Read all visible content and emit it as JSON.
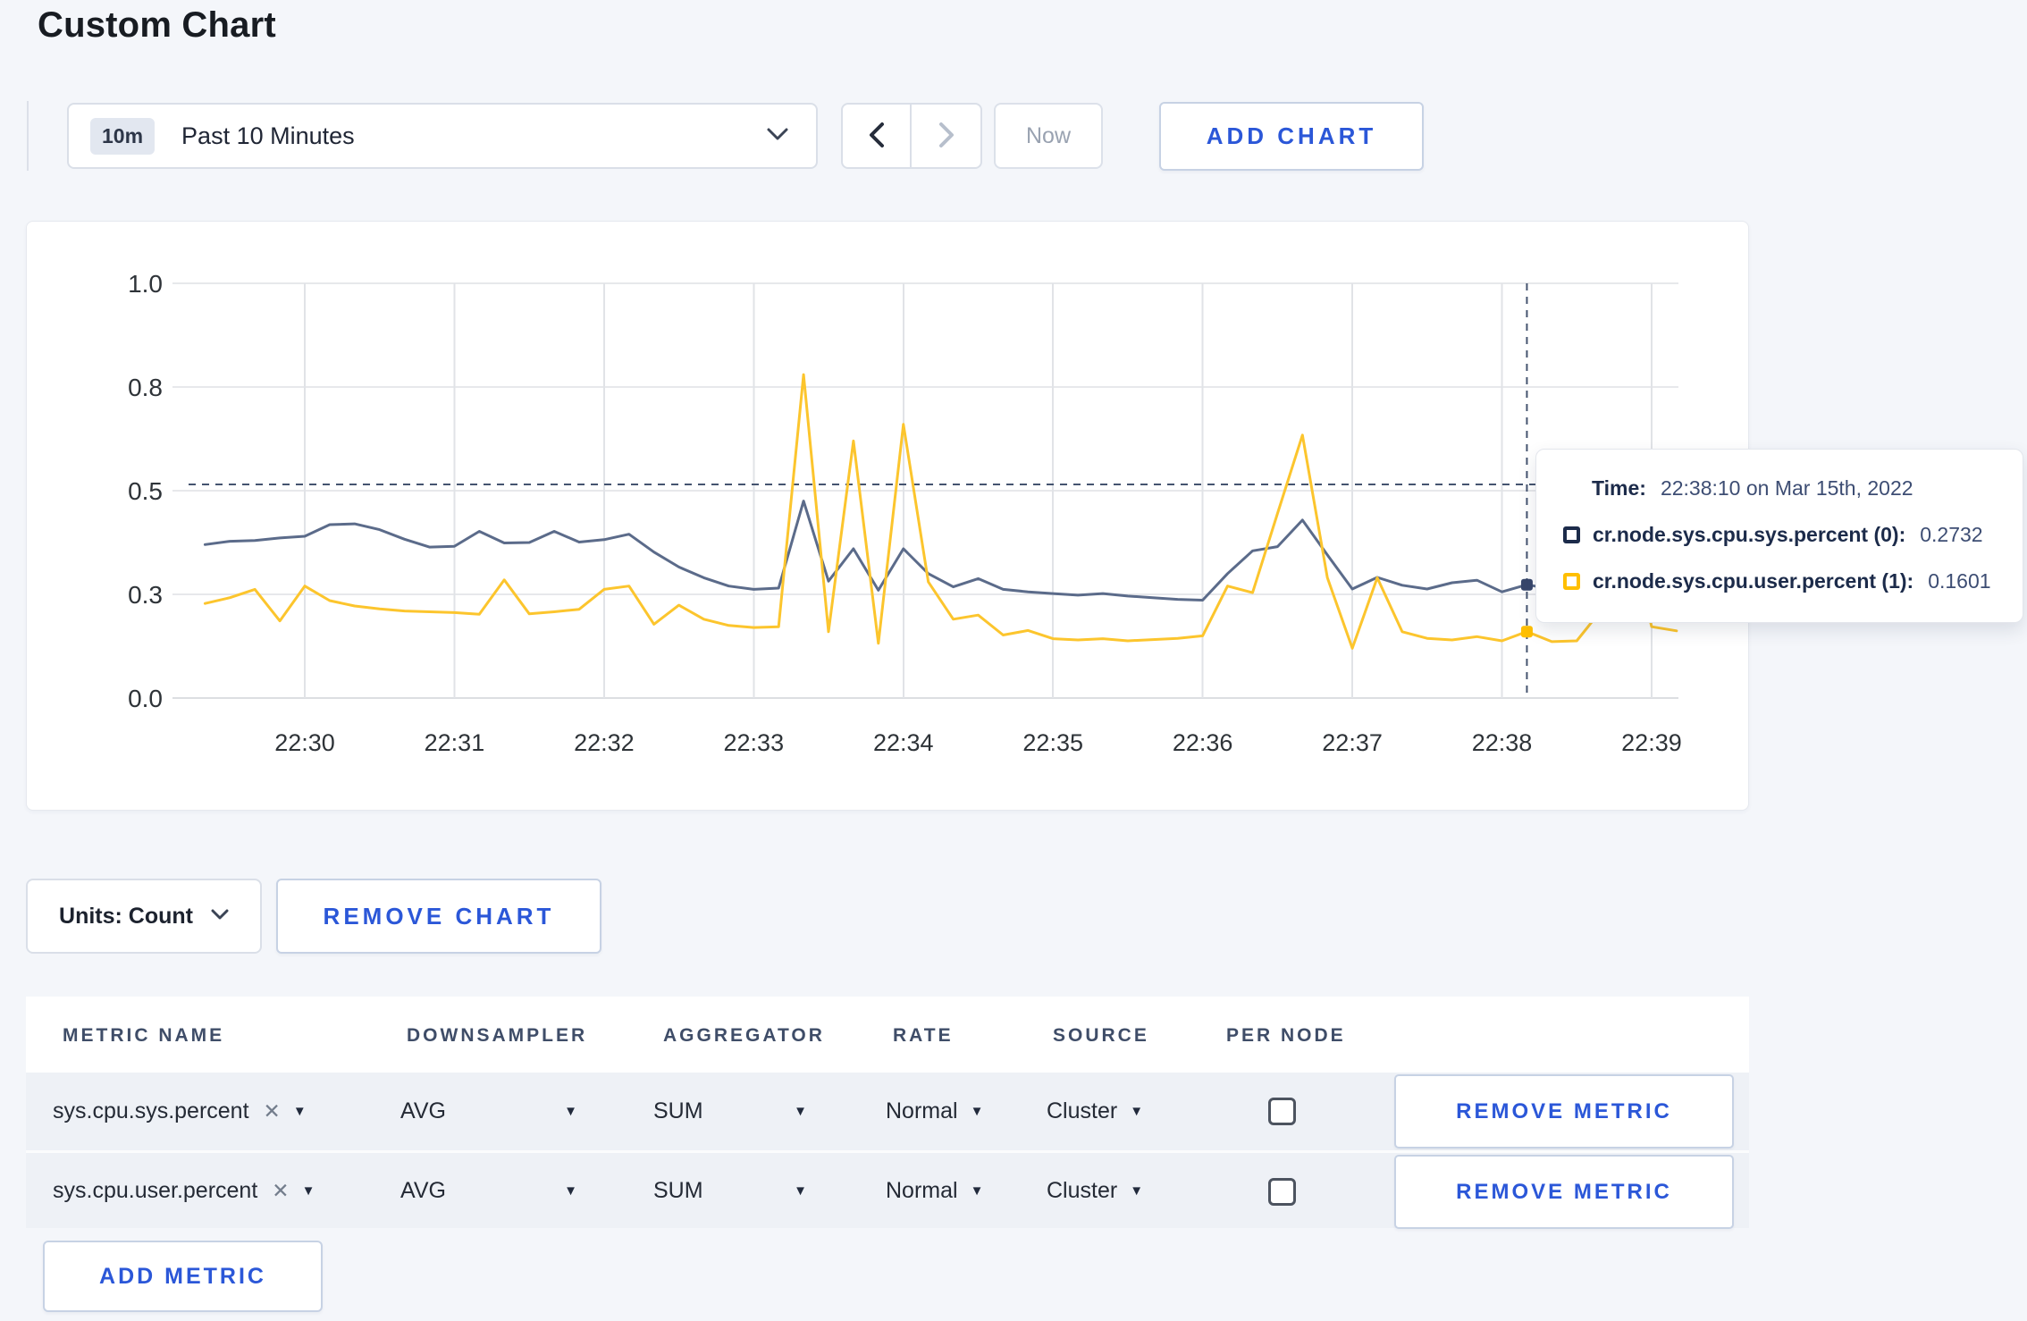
{
  "page": {
    "title": "Custom Chart"
  },
  "toolbar": {
    "time_window": {
      "badge": "10m",
      "label": "Past 10 Minutes"
    },
    "now_label": "Now",
    "add_chart_label": "ADD CHART"
  },
  "chart_data": {
    "type": "line",
    "title": "",
    "xlabel": "",
    "ylabel": "",
    "ylim": [
      0,
      1
    ],
    "grid": true,
    "y_ticks": [
      {
        "v": 0.0,
        "label": "0.0"
      },
      {
        "v": 0.25,
        "label": "0.3"
      },
      {
        "v": 0.5,
        "label": "0.5"
      },
      {
        "v": 0.75,
        "label": "0.8"
      },
      {
        "v": 1.0,
        "label": "1.0"
      }
    ],
    "x_tick_labels": [
      "22:30",
      "22:31",
      "22:32",
      "22:33",
      "22:34",
      "22:35",
      "22:36",
      "22:37",
      "22:38",
      "22:39"
    ],
    "x_first_offset_min": -0.6667,
    "x_step_min": 0.166667,
    "series": [
      {
        "name": "cr.node.sys.cpu.sys.percent",
        "color": "#5b6b8a",
        "marker_color": "#37466b",
        "values": [
          0.37,
          0.378,
          0.38,
          0.386,
          0.39,
          0.418,
          0.42,
          0.406,
          0.383,
          0.364,
          0.366,
          0.402,
          0.374,
          0.375,
          0.402,
          0.376,
          0.382,
          0.395,
          0.352,
          0.316,
          0.29,
          0.27,
          0.262,
          0.265,
          0.475,
          0.282,
          0.36,
          0.26,
          0.36,
          0.3,
          0.268,
          0.288,
          0.262,
          0.256,
          0.252,
          0.248,
          0.252,
          0.246,
          0.242,
          0.238,
          0.236,
          0.3,
          0.355,
          0.365,
          0.429,
          0.345,
          0.263,
          0.291,
          0.272,
          0.263,
          0.278,
          0.284,
          0.256,
          0.2732,
          0.263,
          0.27,
          0.278,
          0.282,
          0.28,
          0.278
        ]
      },
      {
        "name": "cr.node.sys.cpu.user.percent",
        "color": "#fcc52d",
        "marker_color": "#ffbf00",
        "values": [
          0.228,
          0.242,
          0.262,
          0.186,
          0.27,
          0.235,
          0.222,
          0.215,
          0.21,
          0.208,
          0.206,
          0.202,
          0.285,
          0.203,
          0.208,
          0.214,
          0.262,
          0.27,
          0.178,
          0.224,
          0.19,
          0.175,
          0.17,
          0.172,
          0.78,
          0.16,
          0.62,
          0.132,
          0.66,
          0.28,
          0.19,
          0.2,
          0.152,
          0.163,
          0.143,
          0.14,
          0.143,
          0.138,
          0.141,
          0.144,
          0.15,
          0.27,
          0.254,
          0.445,
          0.634,
          0.29,
          0.12,
          0.29,
          0.16,
          0.144,
          0.14,
          0.148,
          0.138,
          0.1601,
          0.136,
          0.138,
          0.213,
          0.42,
          0.172,
          0.162
        ]
      }
    ],
    "crosshair": {
      "x_offset_min": 8.1667,
      "y_value": 0.515,
      "time": "22:38:10",
      "marker_values": [
        0.2732,
        0.1601
      ]
    },
    "legend_position": "tooltip"
  },
  "tooltip": {
    "time_label": "Time:",
    "time_value": "22:38:10 on Mar 15th, 2022",
    "series": [
      {
        "label": "cr.node.sys.cpu.sys.percent (0):",
        "value": "0.2732",
        "color": "#1c2b4a"
      },
      {
        "label": "cr.node.sys.cpu.user.percent (1):",
        "value": "0.1601",
        "color": "#ffbf00"
      }
    ]
  },
  "units_bar": {
    "units_label": "Units: Count",
    "remove_chart_label": "REMOVE CHART"
  },
  "table": {
    "headers": [
      "METRIC NAME",
      "DOWNSAMPLER",
      "AGGREGATOR",
      "RATE",
      "SOURCE",
      "PER NODE"
    ],
    "rows": [
      {
        "metric": "sys.cpu.sys.percent",
        "downsampler": "AVG",
        "aggregator": "SUM",
        "rate": "Normal",
        "source": "Cluster",
        "per_node_checked": false,
        "remove_label": "REMOVE METRIC"
      },
      {
        "metric": "sys.cpu.user.percent",
        "downsampler": "AVG",
        "aggregator": "SUM",
        "rate": "Normal",
        "source": "Cluster",
        "per_node_checked": false,
        "remove_label": "REMOVE METRIC"
      }
    ],
    "add_metric_label": "ADD METRIC"
  }
}
